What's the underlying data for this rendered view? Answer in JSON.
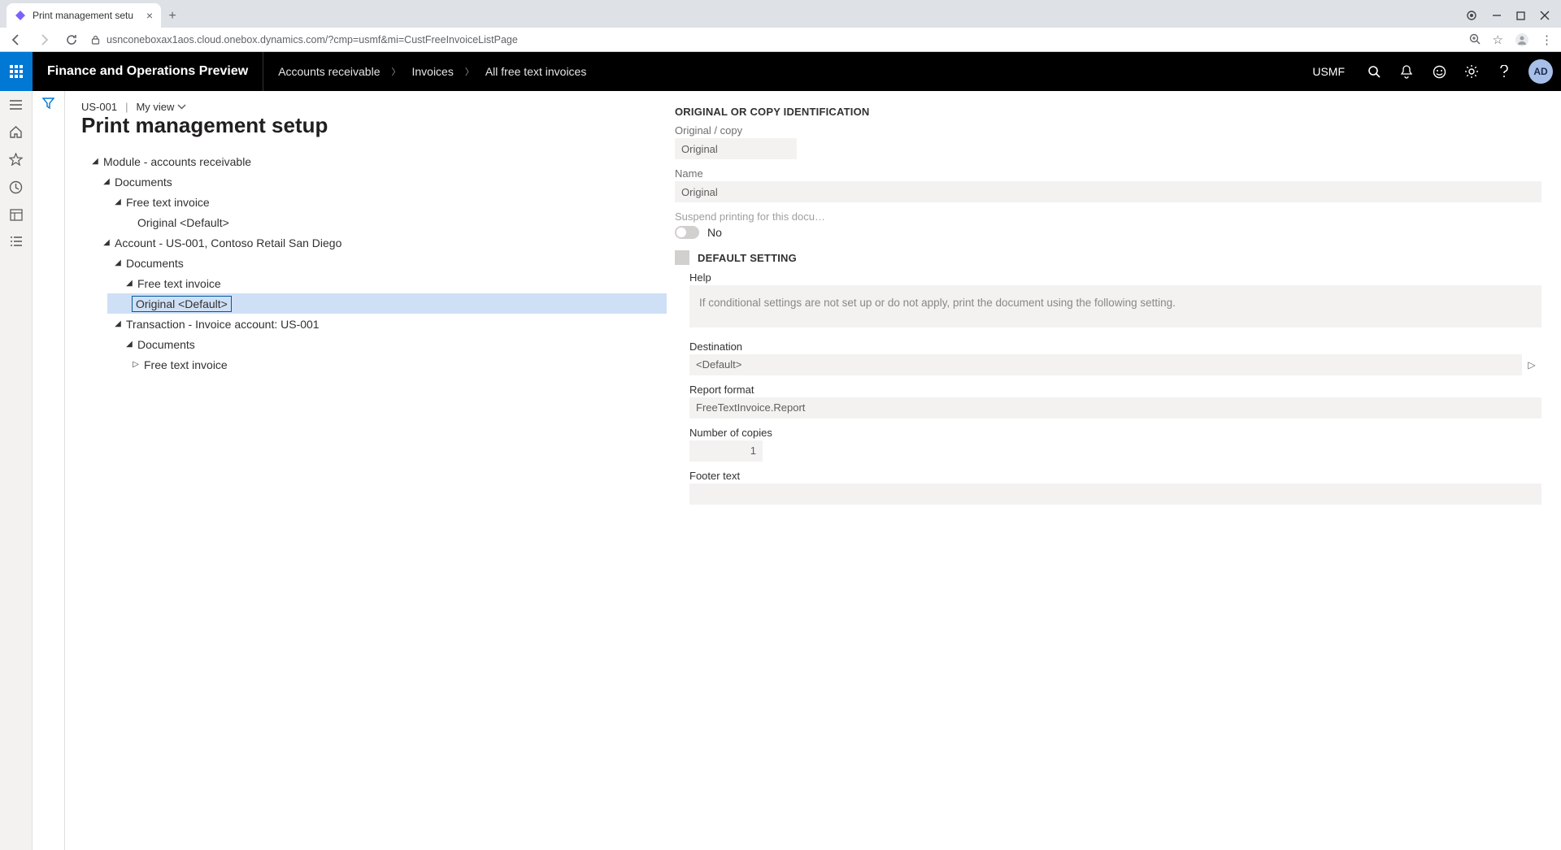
{
  "browser": {
    "tab_title": "Print management setu",
    "url": "usnconeboxax1aos.cloud.onebox.dynamics.com/?cmp=usmf&mi=CustFreeInvoiceListPage"
  },
  "top_nav": {
    "app_title": "Finance and Operations Preview",
    "crumb1": "Accounts receivable",
    "crumb2": "Invoices",
    "crumb3": "All free text invoices",
    "company": "USMF",
    "avatar": "AD"
  },
  "page": {
    "context_id": "US-001",
    "view_label": "My view",
    "title": "Print management setup"
  },
  "tree": {
    "n1": "Module - accounts receivable",
    "n2": "Documents",
    "n3": "Free text invoice",
    "n4": "Original <Default>",
    "n5": "Account - US-001, Contoso Retail San Diego",
    "n6": "Documents",
    "n7": "Free text invoice",
    "n8": "Original <Default>",
    "n9": "Transaction - Invoice account: US-001",
    "n10": "Documents",
    "n11": "Free text invoice"
  },
  "form": {
    "section1_title": "ORIGINAL OR COPY IDENTIFICATION",
    "orig_copy_label": "Original / copy",
    "orig_copy_value": "Original",
    "name_label": "Name",
    "name_value": "Original",
    "suspend_label": "Suspend printing for this docu…",
    "suspend_value": "No",
    "default_title": "DEFAULT SETTING",
    "help_label": "Help",
    "help_text": "If conditional settings are not set up or do not apply, print the document using the following setting.",
    "dest_label": "Destination",
    "dest_value": "<Default>",
    "format_label": "Report format",
    "format_value": "FreeTextInvoice.Report",
    "copies_label": "Number of copies",
    "copies_value": "1",
    "footer_label": "Footer text",
    "footer_value": ""
  }
}
